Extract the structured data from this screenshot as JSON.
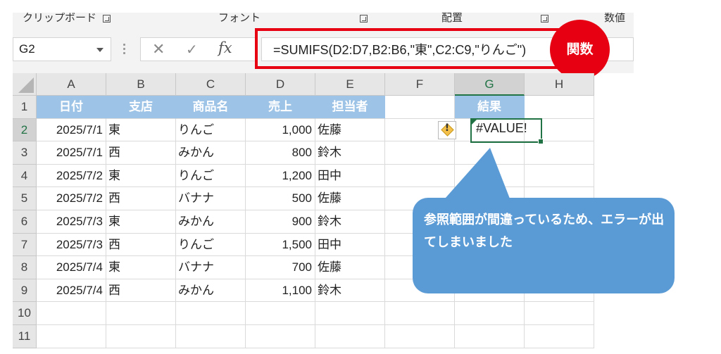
{
  "ribbon": {
    "groups": [
      "クリップボード",
      "フォント",
      "配置",
      "数値"
    ]
  },
  "formula_bar": {
    "name_box": "G2",
    "cancel_icon": "close-icon",
    "enter_icon": "check-icon",
    "fx_label": "fx",
    "formula": "=SUMIFS(D2:D7,B2:B6,\"東\",C2:C9,\"りんご\")"
  },
  "annotation": {
    "badge": "関数",
    "callout": "参照範囲が間違っているため、エラーが出てしまいました",
    "accent_red": "#e60012",
    "callout_color": "#5b9bd5"
  },
  "sheet": {
    "columns": [
      "A",
      "B",
      "C",
      "D",
      "E",
      "F",
      "G",
      "H"
    ],
    "rows": [
      "1",
      "2",
      "3",
      "4",
      "5",
      "6",
      "7",
      "8",
      "9",
      "10",
      "11"
    ],
    "headers": [
      "日付",
      "支店",
      "商品名",
      "売上",
      "担当者"
    ],
    "result_header": "結果",
    "header_color": "#9dc3e6",
    "data": [
      [
        "2025/7/1",
        "東",
        "りんご",
        "1,000",
        "佐藤"
      ],
      [
        "2025/7/1",
        "西",
        "みかん",
        "800",
        "鈴木"
      ],
      [
        "2025/7/2",
        "東",
        "りんご",
        "1,200",
        "田中"
      ],
      [
        "2025/7/2",
        "西",
        "バナナ",
        "500",
        "佐藤"
      ],
      [
        "2025/7/3",
        "東",
        "みかん",
        "900",
        "鈴木"
      ],
      [
        "2025/7/3",
        "西",
        "りんご",
        "1,500",
        "田中"
      ],
      [
        "2025/7/4",
        "東",
        "バナナ",
        "700",
        "佐藤"
      ],
      [
        "2025/7/4",
        "西",
        "みかん",
        "1,100",
        "鈴木"
      ]
    ],
    "active_cell_value": "#VALUE!",
    "warning_icon": "warning-diamond-icon"
  }
}
